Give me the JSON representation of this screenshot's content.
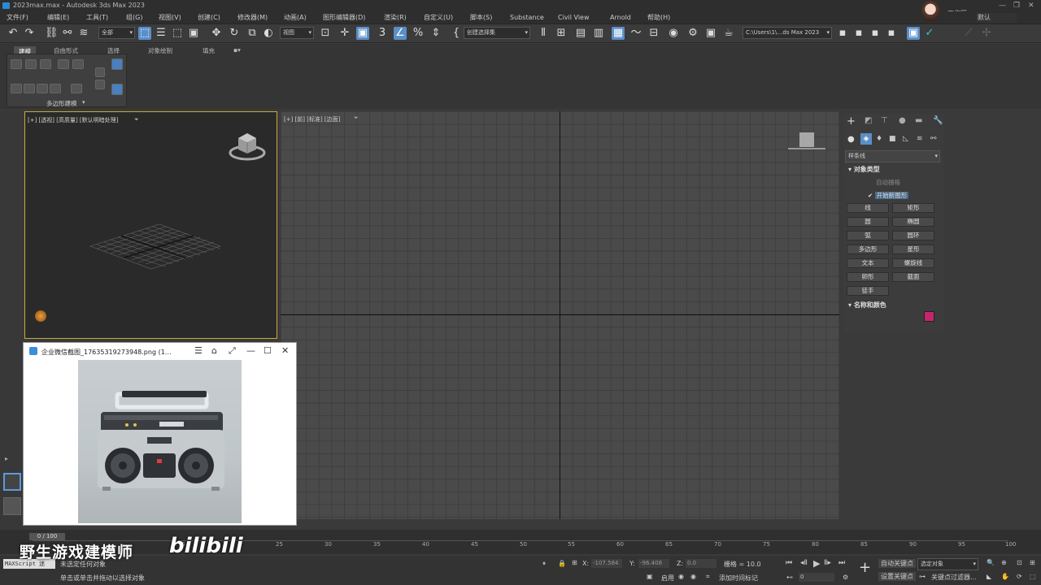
{
  "title": "2023max.max - Autodesk 3ds Max 2023",
  "workspace": {
    "label": "工作区:",
    "value": "默认"
  },
  "menu": [
    "文件(F)",
    "编辑(E)",
    "工具(T)",
    "组(G)",
    "视图(V)",
    "创建(C)",
    "修改器(M)",
    "动画(A)",
    "图形编辑器(D)",
    "渲染(R)",
    "自定义(U)",
    "脚本(S)",
    "Substance",
    "Civil View",
    "Arnold",
    "帮助(H)"
  ],
  "toolbar": {
    "filter": "全部",
    "refcoord": "视图",
    "selset": "创建选择集",
    "path": "C:\\Users\\1\\…ds Max 2023"
  },
  "ribbon": {
    "tabs": [
      "建模",
      "自由形式",
      "选择",
      "对象绘制",
      "填充"
    ],
    "panel_label": "多边形建模"
  },
  "viewports": {
    "persp_label": "[+] [透视] [高质量] [默认明暗处理]",
    "top_label": "[+] [前] [标准] [边面]"
  },
  "command_panel": {
    "category": "样条线",
    "object_type_header": "对象类型",
    "autogrid": "自动栅格",
    "start_new_shape": "开始新图形",
    "buttons": [
      "线",
      "矩形",
      "圆",
      "椭圆",
      "弧",
      "圆环",
      "多边形",
      "星形",
      "文本",
      "螺旋线",
      "卵形",
      "截面",
      "徒手"
    ],
    "name_color_header": "名称和颜色",
    "color": "#c8246b"
  },
  "image_viewer": {
    "title": "企业微信截图_17635319273948.png (1…"
  },
  "timeline": {
    "frame": "0 / 100",
    "ticks": [
      "15",
      "25",
      "30",
      "35",
      "40",
      "45",
      "50",
      "55",
      "60",
      "65",
      "70",
      "75",
      "80",
      "85",
      "90",
      "95",
      "100"
    ]
  },
  "status": {
    "script": "MAXScript 迷",
    "line1": "未选定任何对象",
    "line2": "单击或单击并拖动以选择对象",
    "x_label": "X:",
    "x": "-107.584",
    "y_label": "Y:",
    "y": "-96.408",
    "z_label": "Z:",
    "z": "0.0",
    "grid": "栅格 = 10.0",
    "enable": "启用",
    "add_tag": "添加时间标记",
    "autokey": "自动关键点",
    "selected": "选定对象",
    "setkey": "设置关键点",
    "key_filters": "关键点过滤器...",
    "current_frame": "0"
  },
  "watermark": {
    "text": "野生游戏建模师",
    "brand": "bilibili"
  }
}
